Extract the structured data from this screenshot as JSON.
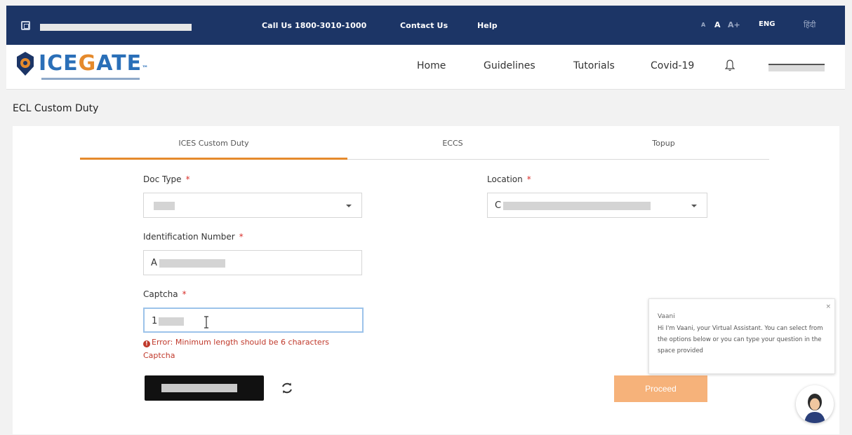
{
  "topbar": {
    "call_us": "Call Us  1800-3010-1000",
    "contact": "Contact Us",
    "help": "Help",
    "font_small": "A",
    "font_normal": "A",
    "font_large": "A+",
    "lang": "ENG",
    "lang_alt": "हिंदी"
  },
  "brand": {
    "logo_a": "ICE",
    "logo_g": "G",
    "logo_b": "ATE",
    "logo_tm": "™",
    "accent": "#e58a2c",
    "primary": "#1c3566"
  },
  "nav": {
    "home": "Home",
    "guidelines": "Guidelines",
    "tutorials": "Tutorials",
    "covid": "Covid-19"
  },
  "page": {
    "title": "ECL Custom Duty"
  },
  "tabs": [
    {
      "label": "ICES Custom Duty"
    },
    {
      "label": "ECCS"
    },
    {
      "label": "Topup"
    }
  ],
  "form": {
    "doc_type_label": "Doc Type",
    "location_label": "Location",
    "location_prefix": "C",
    "identification_label": "Identification Number",
    "identification_prefix": "A",
    "captcha_label": "Captcha",
    "captcha_prefix": "1",
    "required_mark": "*",
    "error_line1": "Error: Minimum length should be 6 characters",
    "error_line2": "Captcha",
    "error_icon": "!",
    "proceed_label": "Proceed"
  },
  "chat": {
    "close": "×",
    "name": "Vaani",
    "message": "Hi I'm Vaani, your Virtual Assistant. You can select from the options below or you can type your question in the space provided"
  }
}
